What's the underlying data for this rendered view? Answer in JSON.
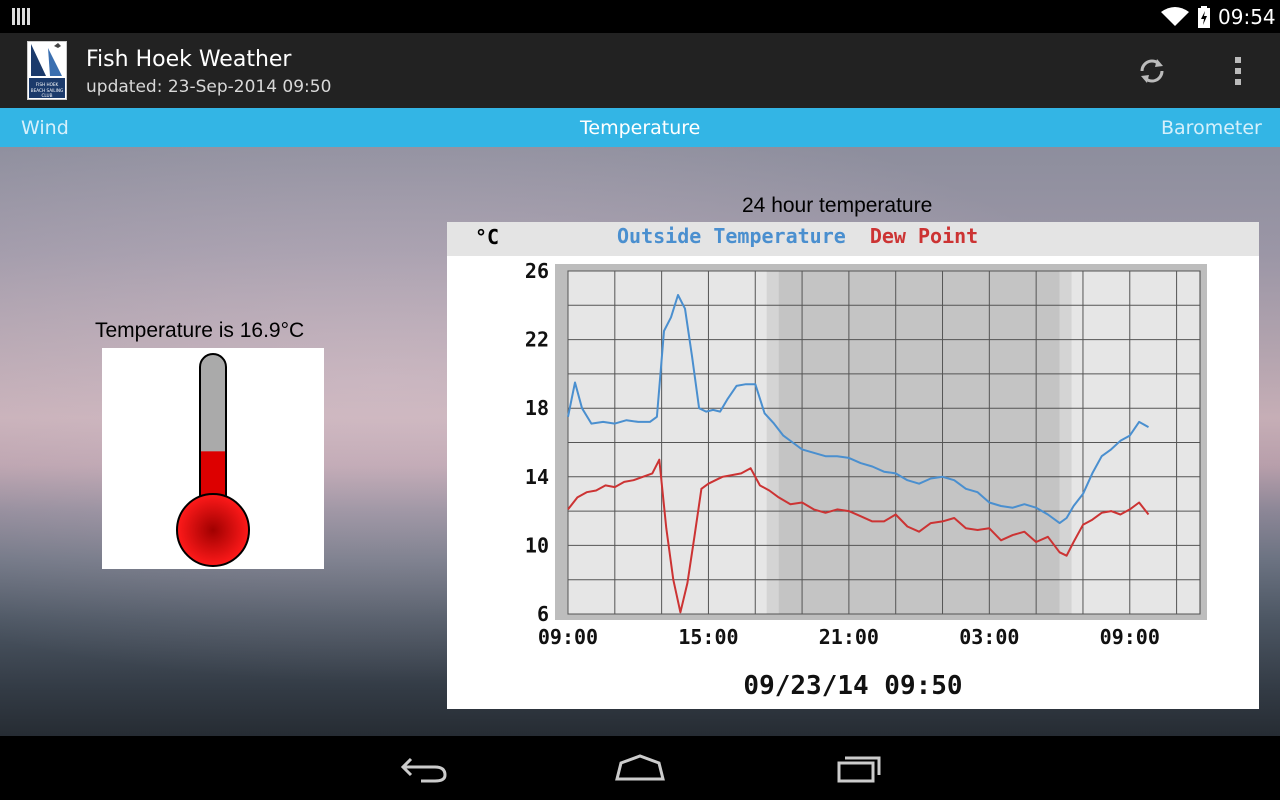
{
  "status_bar": {
    "time": "09:54"
  },
  "app": {
    "title": "Fish Hoek Weather",
    "subtitle": "updated: 23-Sep-2014 09:50",
    "logo_text": "FISH HOEK BEACH SAILING CLUB"
  },
  "tabs": [
    {
      "label": "Wind",
      "active": false
    },
    {
      "label": "Temperature",
      "active": true
    },
    {
      "label": "Barometer",
      "active": false
    }
  ],
  "thermometer": {
    "label": "Temperature is 16.9°C",
    "fill_fraction": 0.43
  },
  "chart_title": "24 hour temperature",
  "chart_data": {
    "type": "line",
    "unit_label": "°C",
    "ylim": [
      6,
      26
    ],
    "y_ticks": [
      6,
      10,
      14,
      18,
      22,
      26
    ],
    "x_tick_labels": [
      "09:00",
      "15:00",
      "21:00",
      "03:00",
      "09:00"
    ],
    "x_hours": [
      0,
      6,
      12,
      18,
      24
    ],
    "x_range_hours": [
      0,
      27
    ],
    "night_shading_hours": [
      9,
      21
    ],
    "grid": true,
    "footer": "09/23/14 09:50",
    "series": [
      {
        "name": "Outside Temperature",
        "color": "#4a8fcf",
        "x": [
          0,
          0.3,
          0.6,
          1,
          1.5,
          2,
          2.5,
          3,
          3.5,
          3.8,
          4.1,
          4.4,
          4.7,
          5,
          5.3,
          5.6,
          5.9,
          6.2,
          6.5,
          6.8,
          7.2,
          7.6,
          8,
          8.4,
          8.8,
          9.2,
          9.6,
          10,
          10.5,
          11,
          11.5,
          12,
          12.5,
          13,
          13.5,
          14,
          14.5,
          15,
          15.5,
          16,
          16.5,
          17,
          17.5,
          18,
          18.5,
          19,
          19.5,
          20,
          20.5,
          21,
          21.3,
          21.6,
          22,
          22.4,
          22.8,
          23.2,
          23.6,
          24,
          24.4,
          24.8
        ],
        "values": [
          17.5,
          19.5,
          18,
          17.1,
          17.2,
          17.1,
          17.3,
          17.2,
          17.2,
          17.5,
          22.5,
          23.3,
          24.6,
          23.8,
          21,
          18,
          17.8,
          17.9,
          17.8,
          18.5,
          19.3,
          19.4,
          19.4,
          17.7,
          17.1,
          16.4,
          16,
          15.6,
          15.4,
          15.2,
          15.2,
          15.1,
          14.8,
          14.6,
          14.3,
          14.2,
          13.8,
          13.6,
          13.9,
          14,
          13.8,
          13.3,
          13.1,
          12.5,
          12.3,
          12.2,
          12.4,
          12.2,
          11.8,
          11.3,
          11.6,
          12.3,
          13,
          14.2,
          15.2,
          15.6,
          16.1,
          16.4,
          17.2,
          16.9
        ]
      },
      {
        "name": "Dew Point",
        "color": "#cc3333",
        "x": [
          0,
          0.4,
          0.8,
          1.2,
          1.6,
          2,
          2.4,
          2.8,
          3.2,
          3.6,
          3.9,
          4.2,
          4.5,
          4.8,
          5.1,
          5.4,
          5.7,
          6,
          6.3,
          6.6,
          7,
          7.4,
          7.8,
          8.2,
          8.6,
          9,
          9.5,
          10,
          10.5,
          11,
          11.5,
          12,
          12.5,
          13,
          13.5,
          14,
          14.5,
          15,
          15.5,
          16,
          16.5,
          17,
          17.5,
          18,
          18.5,
          19,
          19.5,
          20,
          20.5,
          21,
          21.3,
          21.6,
          22,
          22.4,
          22.8,
          23.2,
          23.6,
          24,
          24.4,
          24.8
        ],
        "values": [
          12.1,
          12.8,
          13.1,
          13.2,
          13.5,
          13.4,
          13.7,
          13.8,
          14,
          14.2,
          15,
          11,
          8,
          6.1,
          7.8,
          10.5,
          13.3,
          13.6,
          13.8,
          14,
          14.1,
          14.2,
          14.5,
          13.5,
          13.2,
          12.8,
          12.4,
          12.5,
          12.1,
          11.9,
          12.1,
          12,
          11.7,
          11.4,
          11.4,
          11.8,
          11.1,
          10.8,
          11.3,
          11.4,
          11.6,
          11,
          10.9,
          11,
          10.3,
          10.6,
          10.8,
          10.2,
          10.5,
          9.6,
          9.4,
          10.2,
          11.2,
          11.5,
          11.9,
          12,
          11.8,
          12.1,
          12.5,
          11.8
        ]
      }
    ]
  }
}
